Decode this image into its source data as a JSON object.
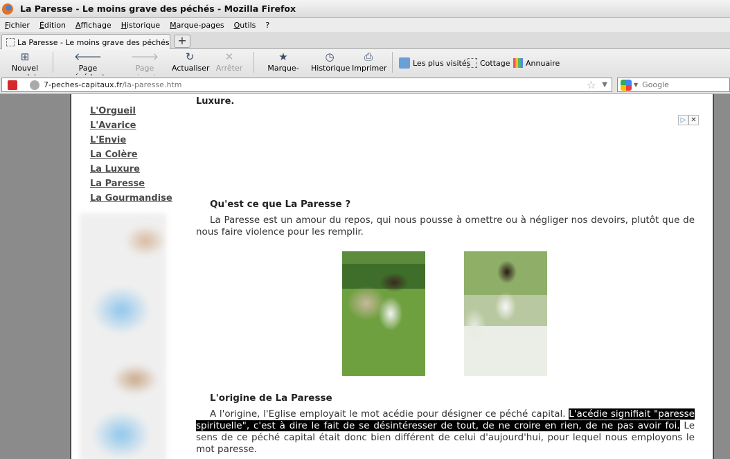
{
  "window": {
    "title": "La Paresse - Le moins grave des péchés - Mozilla Firefox"
  },
  "menu": [
    "Fichier",
    "Édition",
    "Affichage",
    "Historique",
    "Marque-pages",
    "Outils",
    "?"
  ],
  "tab": {
    "label": "La Paresse - Le moins grave des péchés",
    "new_tab_symbol": "+"
  },
  "toolbar": {
    "new_tab": "Nouvel onglet",
    "back": "Page précédente",
    "forward": "Page suivante",
    "reload": "Actualiser",
    "stop": "Arrêter",
    "bookmarks": "Marque-pages",
    "history": "Historique",
    "print": "Imprimer"
  },
  "bookmarks_bar": [
    "Les plus visités",
    "Cottage",
    "Annuaire"
  ],
  "address": {
    "domain": "7-peches-capitaux.fr",
    "path": "/la-paresse.htm"
  },
  "search": {
    "placeholder": "Google"
  },
  "sidebar": {
    "links": [
      "L'Orgueil",
      "L'Avarice",
      "L'Envie",
      "La Colère",
      "La Luxure",
      "La Paresse",
      "La Gourmandise"
    ]
  },
  "content": {
    "lead_text": "Luxure.",
    "section1_title": "Qu'est ce que La Paresse ?",
    "section1_text": "La Paresse est un amour du repos, qui nous pousse à omettre ou à négliger nos devoirs, plutôt que de nous faire violence pour les remplir.",
    "section2_title": "L'origine de La Paresse",
    "section2_text_before": "A l'origine, l'Eglise employait le mot acédie pour désigner ce péché capital. ",
    "section2_text_highlight": "L'acédie signifiait \"paresse spirituelle\", c'est à dire le fait de se désintéresser de tout, de ne croire en rien, de ne pas avoir foi.",
    "section2_text_after": " Le sens de ce péché capital était donc bien différent de celui d'aujourd'hui, pour lequel nous employons le mot paresse."
  },
  "colors": {
    "highlight_bg": "#000000",
    "link": "#4a4a4a",
    "page_bg": "#ffffff",
    "side_bg": "#8b8b8b"
  }
}
